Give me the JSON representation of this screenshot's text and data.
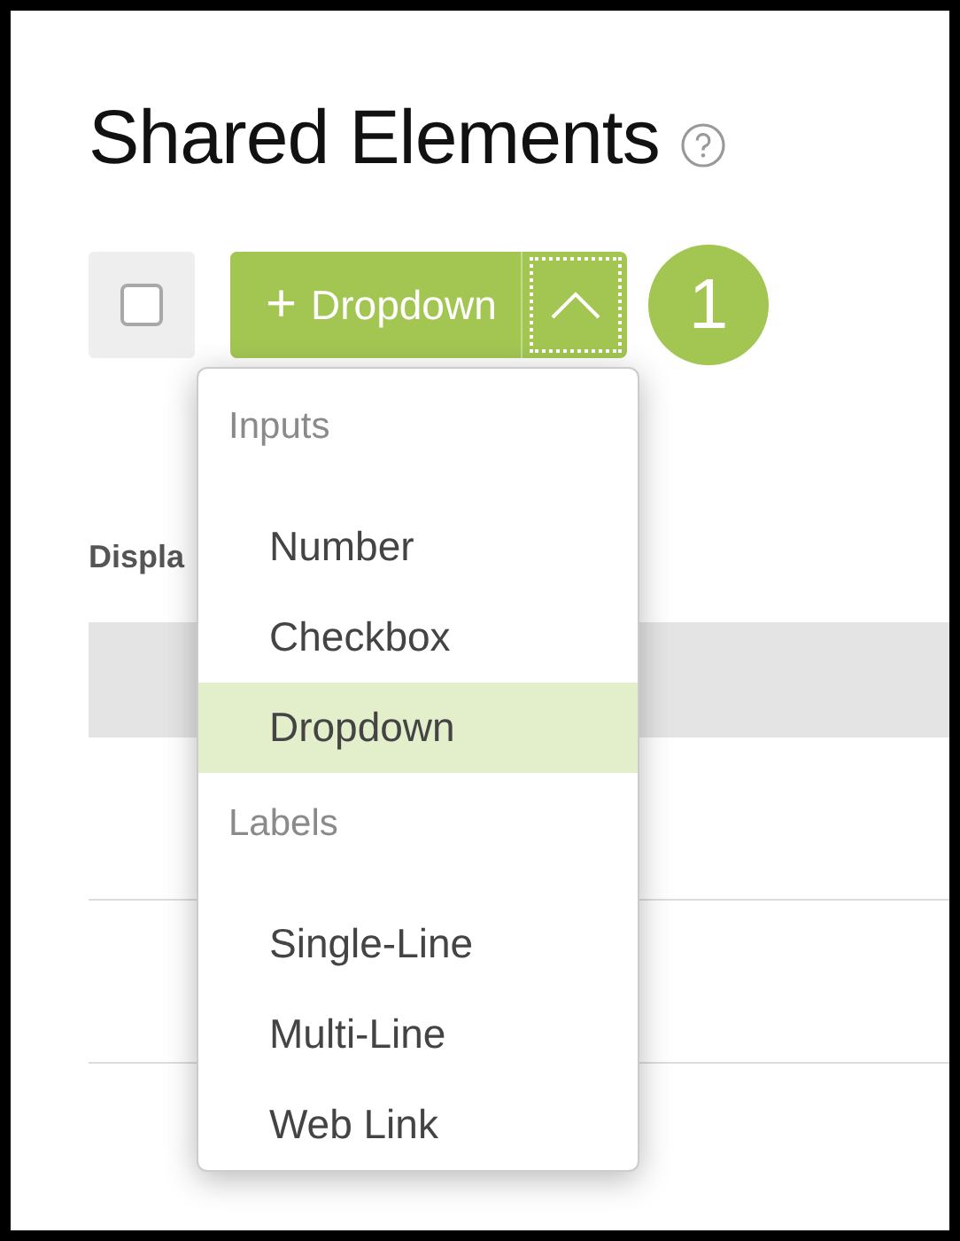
{
  "page": {
    "title": "Shared Elements"
  },
  "toolbar": {
    "select_all": {
      "checked": false
    },
    "add_button": {
      "icon": "+",
      "label": "Dropdown",
      "menu_open": true
    },
    "step_badge": "1"
  },
  "table": {
    "caption": "Displa"
  },
  "menu": {
    "groups": [
      {
        "heading": "Inputs",
        "items": [
          {
            "label": "Number",
            "selected": false
          },
          {
            "label": "Checkbox",
            "selected": false
          },
          {
            "label": "Dropdown",
            "selected": true
          }
        ]
      },
      {
        "heading": "Labels",
        "items": [
          {
            "label": "Single-Line",
            "selected": false
          },
          {
            "label": "Multi-Line",
            "selected": false
          },
          {
            "label": "Web Link",
            "selected": false
          }
        ]
      }
    ]
  }
}
